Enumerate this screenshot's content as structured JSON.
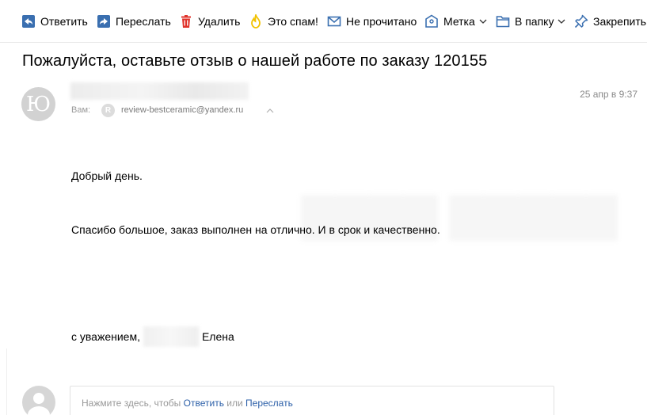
{
  "toolbar": {
    "reply": "Ответить",
    "forward": "Переслать",
    "delete": "Удалить",
    "spam": "Это спам!",
    "unread": "Не прочитано",
    "label": "Метка",
    "to_folder": "В папку",
    "pin": "Закрепить"
  },
  "message": {
    "subject": "Пожалуйста, оставьте отзыв о нашей работе по заказу 120155",
    "avatar_letter": "Ю",
    "to_label": "Вам:",
    "recipient_initial": "R",
    "recipient_email": "review-bestceramic@yandex.ru",
    "date": "25 апр в 9:37",
    "greeting": "Добрый день.",
    "body": "Спасибо большое, заказ выполнен на отлично. И в срок и качественно.",
    "signoff_prefix": "с уважением,",
    "signoff_name": "Елена"
  },
  "quick_reply": {
    "prefix": "Нажмите здесь, чтобы ",
    "reply_link": "Ответить",
    "middle": " или ",
    "forward_link": "Переслать"
  },
  "colors": {
    "icon_blue": "#3a6fb0",
    "delete_red": "#e0332b",
    "spam_yellow": "#f2c200",
    "link_blue": "#2b5fa8"
  }
}
